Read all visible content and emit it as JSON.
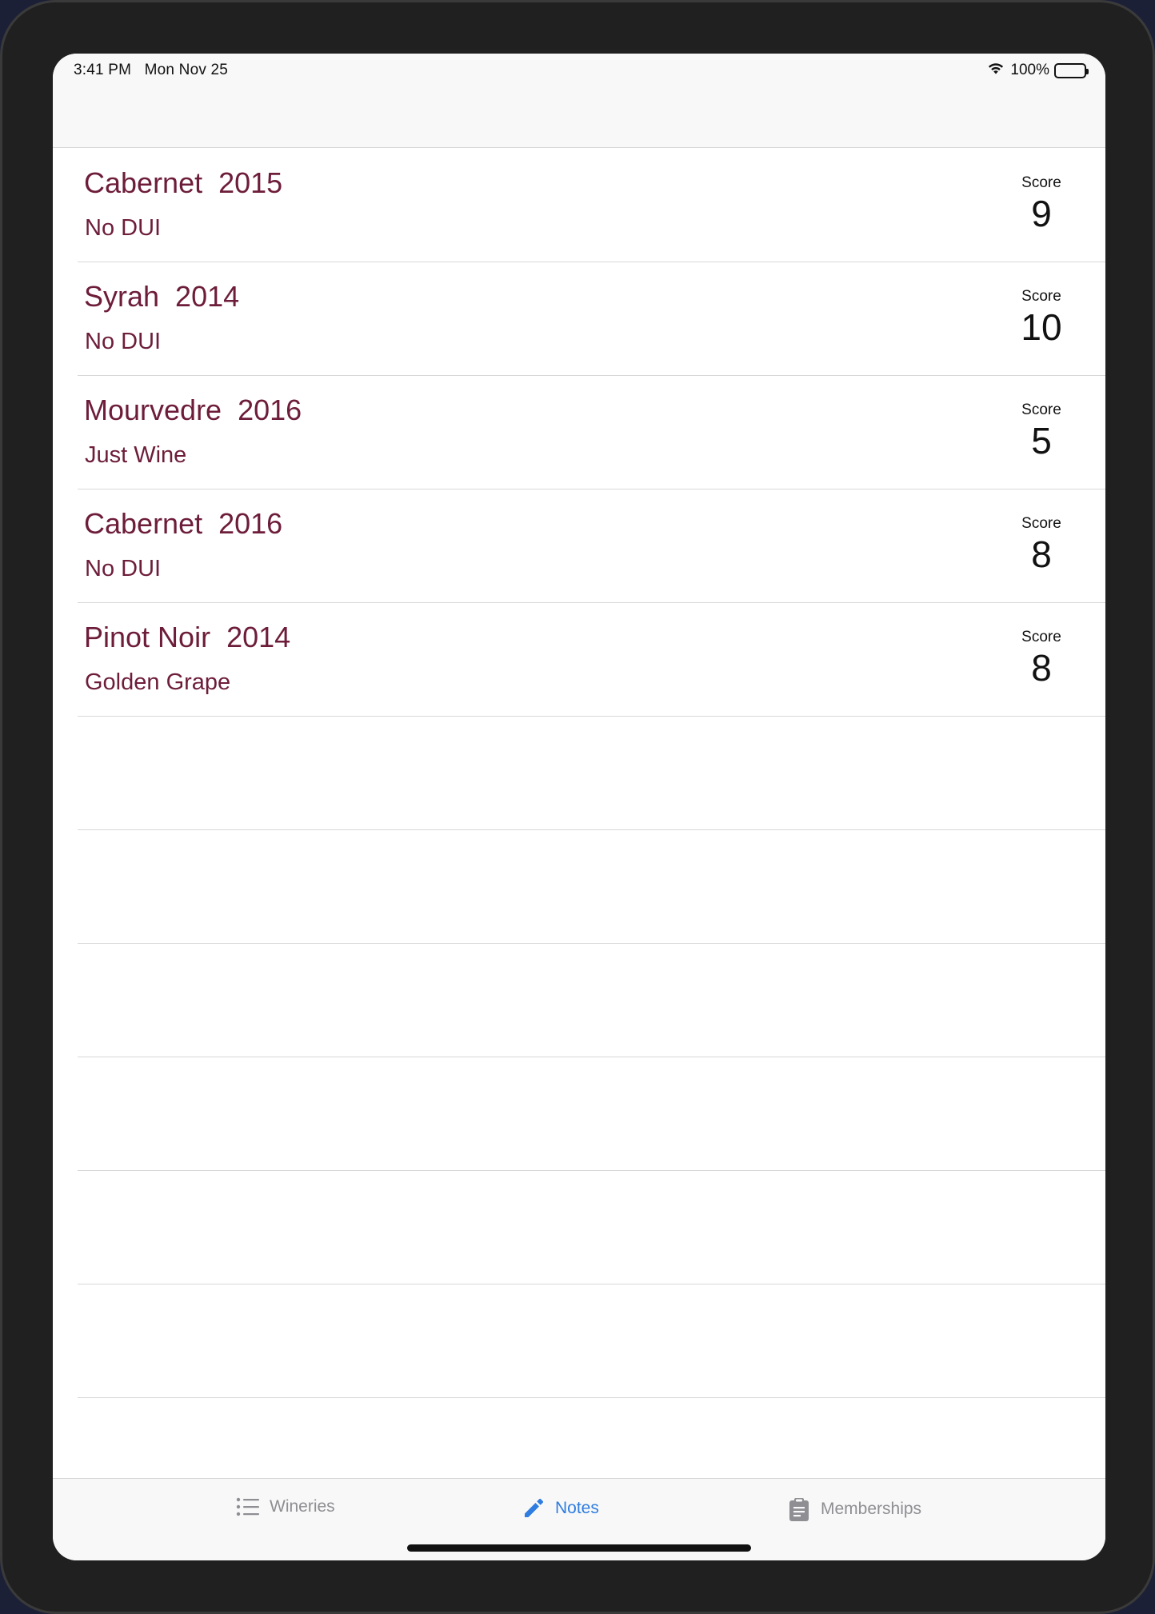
{
  "status_bar": {
    "time": "3:41 PM",
    "date": "Mon Nov 25",
    "battery": "100%",
    "icons": [
      "wifi-icon",
      "battery-icon"
    ]
  },
  "notes": [
    {
      "wine": "Cabernet  2015",
      "winery": "No DUI",
      "score_label": "Score",
      "score": "9"
    },
    {
      "wine": "Syrah  2014",
      "winery": "No DUI",
      "score_label": "Score",
      "score": "10"
    },
    {
      "wine": "Mourvedre  2016",
      "winery": "Just Wine",
      "score_label": "Score",
      "score": "5"
    },
    {
      "wine": "Cabernet  2016",
      "winery": "No DUI",
      "score_label": "Score",
      "score": "8"
    },
    {
      "wine": "Pinot Noir  2014",
      "winery": "Golden Grape",
      "score_label": "Score",
      "score": "8"
    }
  ],
  "tab_bar": {
    "tabs": [
      {
        "label": "Wineries",
        "icon": "list-icon",
        "active": false
      },
      {
        "label": "Notes",
        "icon": "pencil-icon",
        "active": true
      },
      {
        "label": "Memberships",
        "icon": "clipboard-icon",
        "active": false
      }
    ]
  },
  "colors": {
    "wine_text": "#6d1d3a",
    "active_tab": "#2f7de1",
    "inactive_tab": "#8e8e93"
  }
}
